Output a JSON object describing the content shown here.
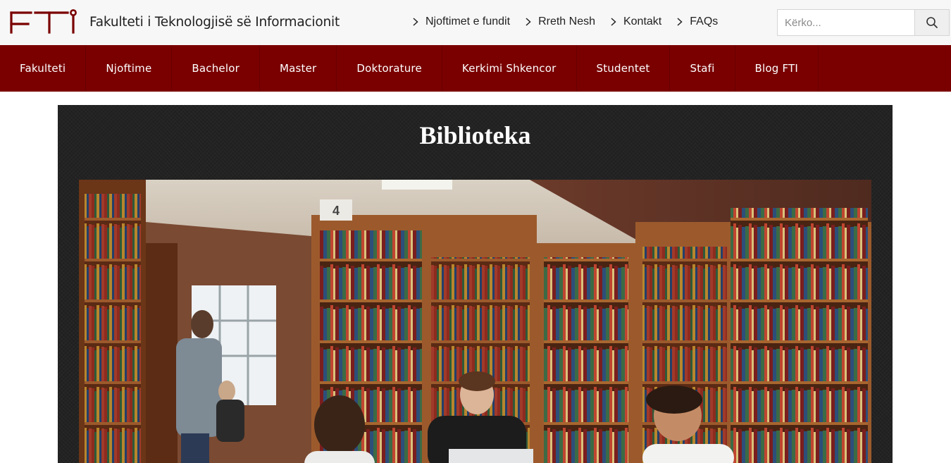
{
  "header": {
    "logo_text": "FTI",
    "site_name": "Fakulteti i Teknologjisë së Informacionit",
    "top_links": [
      {
        "label": "Njoftimet e fundit",
        "icon": "chevron-right-icon"
      },
      {
        "label": "Rreth Nesh",
        "icon": "chevron-right-icon"
      },
      {
        "label": "Kontakt",
        "icon": "chevron-right-icon"
      },
      {
        "label": "FAQs",
        "icon": "chevron-right-icon"
      }
    ],
    "search": {
      "placeholder": "Kërko...",
      "value": "",
      "icon": "search-icon"
    }
  },
  "nav": {
    "items": [
      {
        "label": "Fakulteti"
      },
      {
        "label": "Njoftime"
      },
      {
        "label": "Bachelor"
      },
      {
        "label": "Master"
      },
      {
        "label": "Doktorature"
      },
      {
        "label": "Kerkimi Shkencor"
      },
      {
        "label": "Studentet"
      },
      {
        "label": "Stafi"
      },
      {
        "label": "Blog FTI"
      }
    ]
  },
  "main": {
    "title": "Biblioteka",
    "photo": {
      "description_icon": "library-photo",
      "shelf_number": "4"
    }
  },
  "colors": {
    "brand": "#7a0000",
    "topbar_bg": "#f7f7f7",
    "panel_bg": "#232323"
  }
}
